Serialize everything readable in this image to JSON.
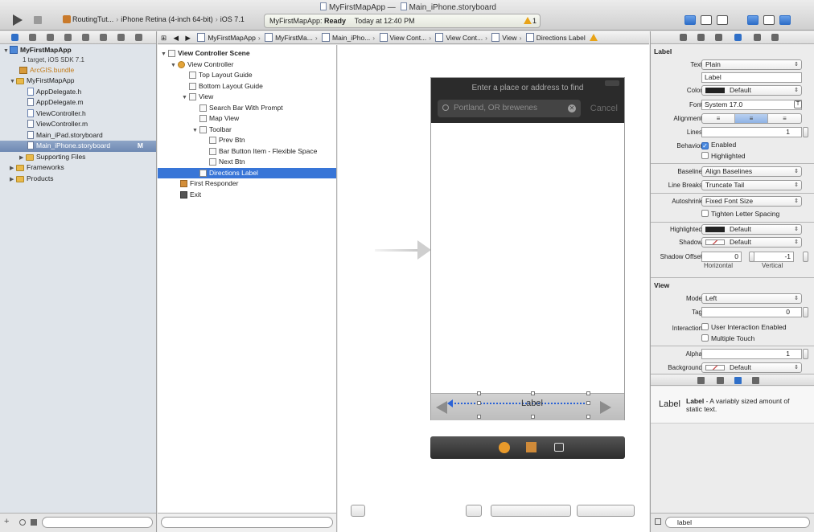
{
  "window": {
    "title_project": "MyFirstMapApp",
    "title_separator": "—",
    "title_file": "Main_iPhone.storyboard"
  },
  "toolbar": {
    "scheme": "RoutingTut...",
    "destination": "iPhone Retina (4-inch 64-bit)",
    "sdk": "iOS 7.1",
    "status_app": "MyFirstMapApp:",
    "status_state": "Ready",
    "status_time": "Today at 12:40 PM",
    "warning_count": "1"
  },
  "navigator": {
    "project_name": "MyFirstMapApp",
    "project_sub": "1 target, iOS SDK 7.1",
    "items": [
      {
        "label": "ArcGIS.bundle"
      },
      {
        "label": "MyFirstMapApp"
      },
      {
        "label": "AppDelegate.h"
      },
      {
        "label": "AppDelegate.m"
      },
      {
        "label": "ViewController.h"
      },
      {
        "label": "ViewController.m"
      },
      {
        "label": "Main_iPad.storyboard"
      },
      {
        "label": "Main_iPhone.storyboard",
        "badge": "M"
      },
      {
        "label": "Supporting Files"
      },
      {
        "label": "Frameworks"
      },
      {
        "label": "Products"
      }
    ]
  },
  "jumpbar": {
    "crumbs": [
      "MyFirstMapApp",
      "MyFirstMa...",
      "Main_iPho...",
      "View Cont...",
      "View Cont...",
      "View",
      "Directions Label"
    ]
  },
  "outline": {
    "items": [
      {
        "label": "View Controller Scene"
      },
      {
        "label": "View Controller"
      },
      {
        "label": "Top Layout Guide"
      },
      {
        "label": "Bottom Layout Guide"
      },
      {
        "label": "View"
      },
      {
        "label": "Search Bar With Prompt"
      },
      {
        "label": "Map View"
      },
      {
        "label": "Toolbar"
      },
      {
        "label": "Prev Btn"
      },
      {
        "label": "Bar Button Item - Flexible Space"
      },
      {
        "label": "Next Btn"
      },
      {
        "label": "Directions Label"
      },
      {
        "label": "First Responder"
      },
      {
        "label": "Exit"
      }
    ]
  },
  "canvas": {
    "prompt": "Enter a place or address to find",
    "search_placeholder": "Portland, OR brewenes",
    "cancel": "Cancel",
    "label_text": "Label"
  },
  "inspector": {
    "label_section": "Label",
    "text_label": "Text",
    "text_value": "Plain",
    "text_field": "Label",
    "color_label": "Color",
    "color_value": "Default",
    "font_label": "Font",
    "font_value": "System 17.0",
    "alignment_label": "Alignment",
    "lines_label": "Lines",
    "lines_value": "1",
    "behavior_label": "Behavior",
    "enabled": "Enabled",
    "highlighted_chk": "Highlighted",
    "baseline_label": "Baseline",
    "baseline_value": "Align Baselines",
    "linebreaks_label": "Line Breaks",
    "linebreaks_value": "Truncate Tail",
    "autoshrink_label": "Autoshrink",
    "autoshrink_value": "Fixed Font Size",
    "tighten": "Tighten Letter Spacing",
    "highlighted_label": "Highlighted",
    "highlighted_value": "Default",
    "shadow_label": "Shadow",
    "shadow_value": "Default",
    "shadow_offset_label": "Shadow Offset",
    "shadow_h": "0",
    "shadow_v": "-1",
    "horizontal": "Horizontal",
    "vertical": "Vertical",
    "view_section": "View",
    "mode_label": "Mode",
    "mode_value": "Left",
    "tag_label": "Tag",
    "tag_value": "0",
    "interaction_label": "Interaction",
    "user_interaction": "User Interaction Enabled",
    "multiple_touch": "Multiple Touch",
    "alpha_label": "Alpha",
    "alpha_value": "1",
    "background_label": "Background",
    "background_value": "Default",
    "library_big": "Label",
    "library_title": "Label",
    "library_desc": " - A variably sized amount of static text.",
    "filter_value": "label"
  }
}
